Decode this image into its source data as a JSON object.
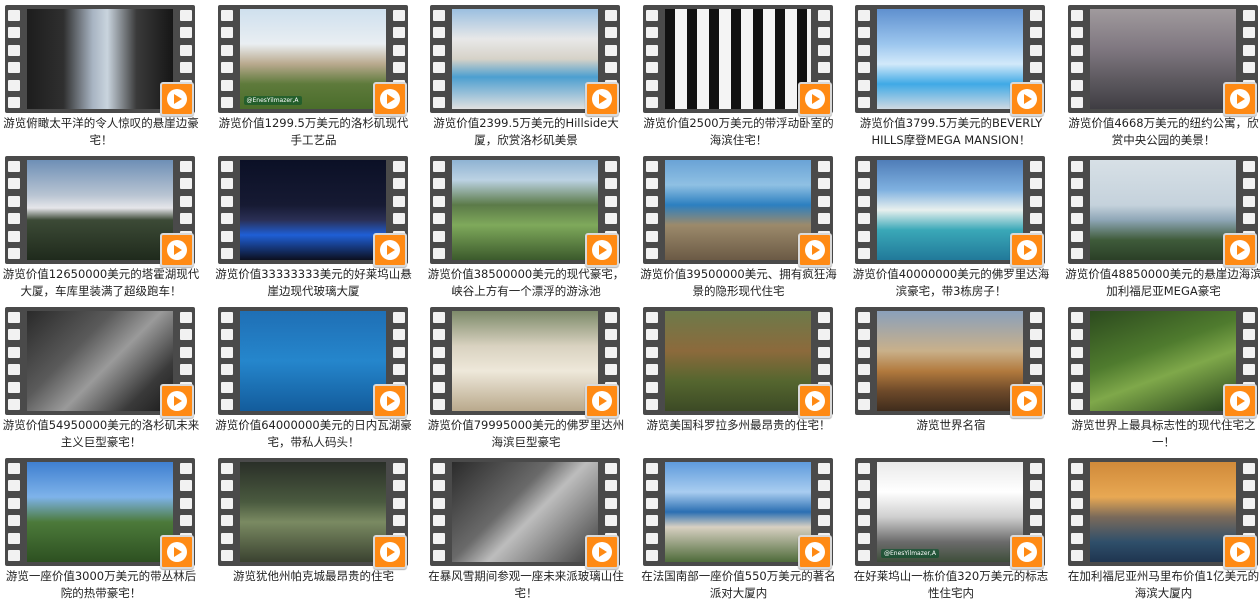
{
  "colors": {
    "play_button": "#ff8a14",
    "film_strip": "#4a4a4a",
    "text": "#222222"
  },
  "icons": {
    "play": "play-button-icon"
  },
  "videos": [
    {
      "title": "游览俯瞰太平洋的令人惊叹的悬崖边豪宅！",
      "bg": "linear-gradient(90deg,#1d1d1d 0%,#2f2f2f 25%,#a8b4c2 45%,#c9d4de 55%,#3a3a3a 75%,#161616 100%)"
    },
    {
      "title": "游览价值1299.5万美元的洛杉矶现代手工艺品",
      "bg": "linear-gradient(180deg,#cfe0ee 0%,#e9eef2 35%,#b9a98e 55%,#5e7a3b 75%,#4a6d2b 100%)",
      "watermark": "@EnesYilmazer,A"
    },
    {
      "title": "游览价值2399.5万美元的Hillside大厦，欣赏洛杉矶美景",
      "bg": "linear-gradient(180deg,#9bbfe0 0%,#e8e8e8 30%,#d6d2c8 50%,#4c9fd0 68%,#e0e0e0 100%)"
    },
    {
      "title": "游览价值2500万美元的带浮动卧室的海滨住宅！",
      "bg": "repeating-linear-gradient(90deg,#111 0 10px,#f4f4f4 10px 22px),#fff"
    },
    {
      "title": "游览价值3799.5万美元的BEVERLY HILLS摩登MEGA MANSION！",
      "bg": "linear-gradient(180deg,#5f90cf 0%,#9cc6ee 35%,#d2e9fa 55%,#3fa9e6 75%,#cfd9e2 100%)"
    },
    {
      "title": "游览价值4668万美元的纽约公寓，欣赏中央公园的美景！",
      "bg": "linear-gradient(180deg,#a09a9d 0%,#7f7780 40%,#5e5a60 70%,#3f3d43 100%)"
    },
    {
      "title": "游览价值12650000美元的塔霍湖现代大厦，车库里装满了超级跑车！",
      "bg": "linear-gradient(180deg,#6e8fb6 0%,#b8c4d2 35%,#e6e6ea 48%,#3c4a36 60%,#1f2a1c 100%)"
    },
    {
      "title": "游览价值33333333美元的好莱坞山悬崖边现代玻璃大厦",
      "bg": "linear-gradient(180deg,#0b1026 0%,#161a33 45%,#2a2f55 60%,#1f5fd6 75%,#0c0f1f 100%)"
    },
    {
      "title": "游览价值38500000美元的现代豪宅，峡谷上方有一个漂浮的游泳池",
      "bg": "linear-gradient(180deg,#8fb3d3 0%,#bcd2e3 20%,#5b7a48 45%,#7fa95b 65%,#3b5a2c 100%)"
    },
    {
      "title": "游览价值39500000美元、拥有疯狂海景的隐形现代住宅",
      "bg": "linear-gradient(180deg,#6aa3d6 0%,#8fc0e3 25%,#2c7fc0 45%,#9c8a6b 65%,#6b5a45 100%)"
    },
    {
      "title": "游览价值40000000美元的佛罗里达海滨豪宅，带3栋房子！",
      "bg": "linear-gradient(180deg,#4f7db8 0%,#7fb1e0 30%,#e8f0ee 50%,#3aa8b8 70%,#21799a 100%)"
    },
    {
      "title": "游览价值48850000美元的悬崖边海滨加利福尼亚MEGA豪宅",
      "bg": "linear-gradient(180deg,#d7e0e6 0%,#c5d2dc 45%,#8ea6b6 60%,#3f5b3a 80%,#2b3f27 100%)"
    },
    {
      "title": "游览价值54950000美元的洛杉矶未来主义巨型豪宅！",
      "bg": "linear-gradient(135deg,#2a2a2a 0%,#5a5a5a 35%,#9a9a9a 55%,#3a3a3a 80%,#1a1a1a 100%)"
    },
    {
      "title": "游览价值64000000美元的日内瓦湖豪宅，带私人码头！",
      "bg": "linear-gradient(180deg,#1f6fb5 0%,#2586cc 50%,#135c9c 100%)"
    },
    {
      "title": "游览价值79995000美元的佛罗里达州海滨巨型豪宅",
      "bg": "linear-gradient(180deg,#7d8a6a 0%,#d9d2c0 35%,#eee8da 60%,#b9a98c 100%)"
    },
    {
      "title": "游览美国科罗拉多州最昂贵的住宅！",
      "bg": "linear-gradient(180deg,#6d7a4a 0%,#8c6a3c 40%,#55662f 70%,#3c4a25 100%)"
    },
    {
      "title": "游览世界名宿",
      "bg": "linear-gradient(180deg,#8aa0bb 0%,#c9b08a 40%,#b27a3e 60%,#6e4a2a 80%,#3f2c1c 100%)"
    },
    {
      "title": "游览世界上最具标志性的现代住宅之一！",
      "bg": "linear-gradient(160deg,#2c4a1e 0%,#4f7b2e 40%,#7fa84a 60%,#25401a 100%)"
    },
    {
      "title": "游览一座价值3000万美元的带丛林后院的热带豪宅！",
      "bg": "linear-gradient(180deg,#3f7fd0 0%,#7eb3ea 35%,#4c7a3a 60%,#2d5021 100%)"
    },
    {
      "title": "游览犹他州帕克城最昂贵的住宅",
      "bg": "linear-gradient(180deg,#2a2f28 0%,#4a5a3f 40%,#7a8a62 60%,#3a4230 100%)"
    },
    {
      "title": "在暴风雪期间参观一座未来派玻璃山住宅！",
      "bg": "linear-gradient(135deg,#2b2b2b 0%,#6a6a6a 40%,#bdbdbd 55%,#3c3c3c 100%)"
    },
    {
      "title": "在法国南部一座价值550万美元的著名派对大厦内",
      "bg": "linear-gradient(180deg,#5f9bdc 0%,#a9cdf0 30%,#2b6fb2 50%,#d8d0c2 65%,#4e6b3a 100%)"
    },
    {
      "title": "在好莱坞山一栋价值320万美元的标志性住宅内",
      "bg": "linear-gradient(180deg,#eaeaea 0%,#ffffff 30%,#cfcfcf 55%,#6b6b6b 80%,#3e4e3a 100%)",
      "watermark": "@EnesYilmazer,A"
    },
    {
      "title": "在加利福尼亚州马里布价值1亿美元的海滨大厦内",
      "bg": "linear-gradient(180deg,#d08a3a 0%,#e8a853 35%,#7a6a5a 55%,#2f4f6a 80%,#1f3550 100%)"
    }
  ]
}
